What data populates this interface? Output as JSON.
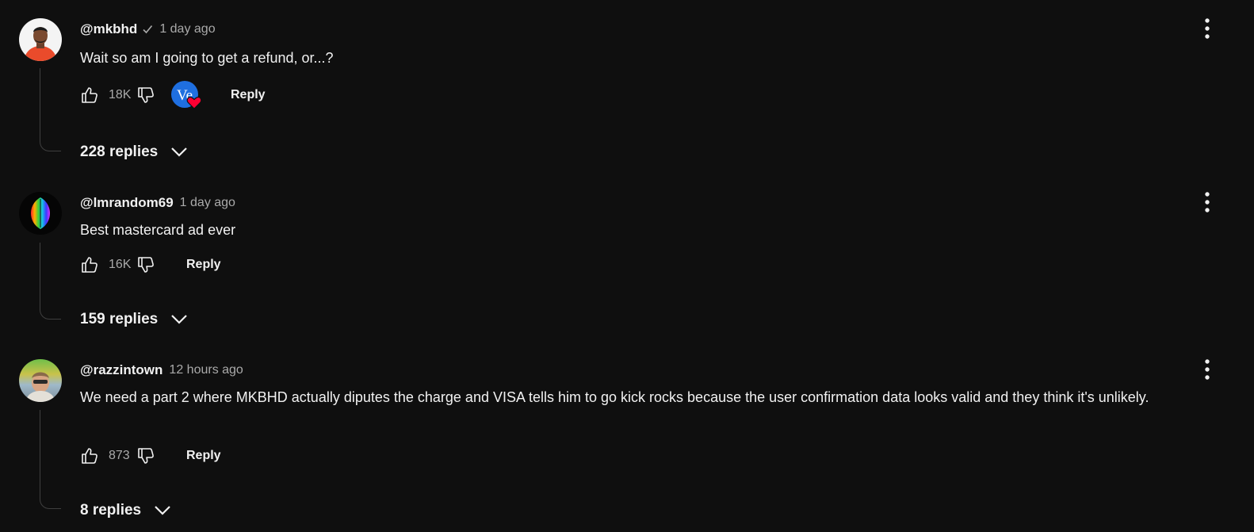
{
  "comments": [
    {
      "author": "@mkbhd",
      "verified": true,
      "time": "1 day ago",
      "text": "Wait so am I going to get a refund, or...?",
      "likes": "18K",
      "creator_heart_initials": "Ve",
      "reply_label": "Reply",
      "replies_label": "228 replies"
    },
    {
      "author": "@lmrandom69",
      "verified": false,
      "time": "1 day ago",
      "text": "Best mastercard ad ever",
      "likes": "16K",
      "reply_label": "Reply",
      "replies_label": "159 replies"
    },
    {
      "author": "@razzintown",
      "verified": false,
      "time": "12 hours ago",
      "text": "We need a part 2 where MKBHD actually diputes the charge and VISA tells him to go kick rocks because the user confirmation data looks valid and they think it's unlikely.",
      "likes": "873",
      "reply_label": "Reply",
      "replies_label": "8 replies"
    }
  ],
  "icons": {
    "like": "thumbs-up-icon",
    "dislike": "thumbs-down-icon",
    "menu": "more-vertical-icon",
    "expand": "chevron-down-icon",
    "verified": "checkmark-icon",
    "heart": "heart-icon"
  },
  "colors": {
    "background": "#0f0f0f",
    "text": "#f1f1f1",
    "secondary_text": "#aaaaaa",
    "heart": "#ff0033",
    "heart_avatar": "#1f6fe0"
  }
}
